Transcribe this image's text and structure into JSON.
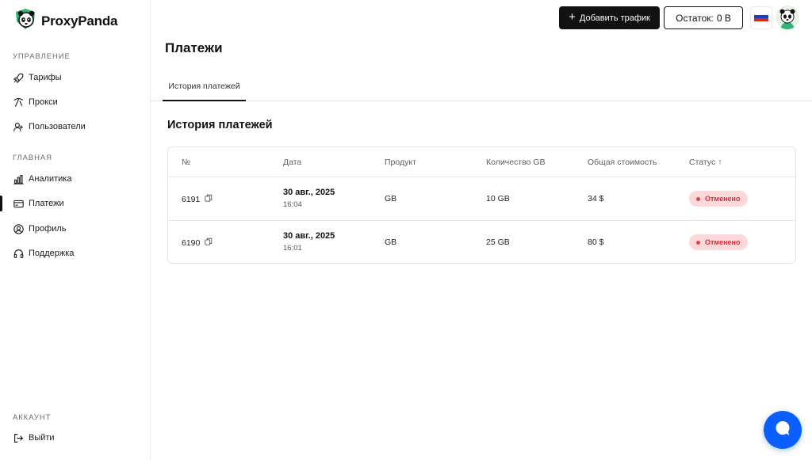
{
  "brand": {
    "name": "ProxyPanda"
  },
  "sidebar": {
    "sections": [
      {
        "title": "УПРАВЛЕНИЕ"
      },
      {
        "title": "ГЛАВНАЯ"
      },
      {
        "title": "АККАУНТ"
      }
    ],
    "items": [
      {
        "label": "Тарифы",
        "icon": "rocket-icon"
      },
      {
        "label": "Прокси",
        "icon": "pickaxe-icon"
      },
      {
        "label": "Пользователи",
        "icon": "users-icon"
      },
      {
        "label": "Аналитика",
        "icon": "bar-chart-icon"
      },
      {
        "label": "Платежи",
        "icon": "wallet-icon",
        "active": true
      },
      {
        "label": "Профиль",
        "icon": "user-circle-icon"
      },
      {
        "label": "Поддержка",
        "icon": "headset-icon"
      },
      {
        "label": "Выйти",
        "icon": "logout-icon"
      }
    ]
  },
  "header": {
    "add_traffic_label": "Добавить трафик",
    "balance_label": "Остаток:",
    "balance_value": "0 B",
    "language": "ru-flag-icon"
  },
  "page": {
    "title": "Платежи",
    "tabs": [
      {
        "label": "История платежей",
        "active": true
      }
    ],
    "section_heading": "История платежей"
  },
  "table": {
    "columns": [
      "№",
      "Дата",
      "Продукт",
      "Количество GB",
      "Общая стоимость",
      "Статус"
    ],
    "sort_indicator": "↑",
    "rows": [
      {
        "id": "6191",
        "date": "30 авг., 2025",
        "time": "16:04",
        "product": "GB",
        "amount": "10 GB",
        "total": "34 $",
        "status": "Отменено"
      },
      {
        "id": "6190",
        "date": "30 авг., 2025",
        "time": "16:01",
        "product": "GB",
        "amount": "25 GB",
        "total": "80 $",
        "status": "Отменено"
      }
    ]
  },
  "colors": {
    "primary": "#111111",
    "status_cancelled_bg": "#fbd9db",
    "status_cancelled_text": "#d0303a",
    "chat_button": "#0b5fff"
  }
}
